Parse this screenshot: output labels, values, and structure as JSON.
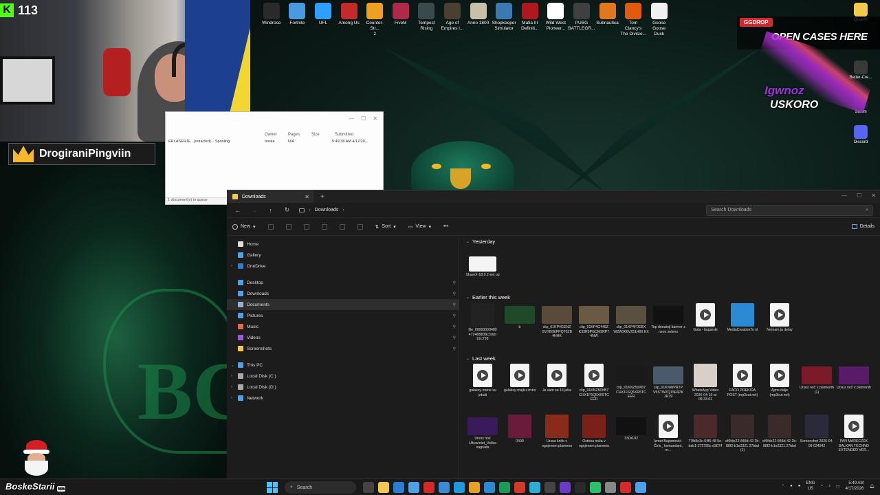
{
  "stream": {
    "kick_count": "113",
    "streamer_name": "DrogiraniPingviin",
    "bottom_name": "BoskeStarii",
    "bottom_tag": "kick"
  },
  "desktop_icons": [
    {
      "label": "Windrose",
      "color": "#2a2a2a"
    },
    {
      "label": "Fortnite",
      "color": "#4a9ae0"
    },
    {
      "label": "UFL",
      "color": "#2fa0ff"
    },
    {
      "label": "Among Us",
      "color": "#c42a2a"
    },
    {
      "label": "Counter-Str...\n2",
      "color": "#f0a020"
    },
    {
      "label": "FiveM",
      "color": "#b0284a"
    },
    {
      "label": "Tempest\nRising",
      "color": "#3a4a4a"
    },
    {
      "label": "Age of\nEmpires I...",
      "color": "#4a4030"
    },
    {
      "label": "Anno 1800",
      "color": "#c8c0a8"
    },
    {
      "label": "Shopkeeper\nSimulator",
      "color": "#3a7ab0"
    },
    {
      "label": "Mafia III\nDefiniti...",
      "color": "#b01820"
    },
    {
      "label": "Wild West\nPioneer...",
      "color": "#ffffff"
    },
    {
      "label": "PUBG\nBATTLEGR...",
      "color": "#404040"
    },
    {
      "label": "Subnautica",
      "color": "#e07820"
    },
    {
      "label": "Tom Clancy's\nThe Divisio...",
      "color": "#e05a10"
    },
    {
      "label": "Goose Goose\nDuck",
      "color": "#f0f0f0"
    }
  ],
  "right_icons": [
    {
      "label": "QuantV",
      "color": "#f2c94c"
    },
    {
      "label": "Better-Cre...",
      "color": "#3a3a3a"
    },
    {
      "label": "Steam",
      "color": "#1b2838"
    },
    {
      "label": "Discord",
      "color": "#5865f2"
    }
  ],
  "ad": {
    "brand": "GGDROP",
    "headline": "OPEN CASES HERE",
    "promo_1": "Igwnoz",
    "promo_2": "USKORO"
  },
  "print_queue": {
    "headers": [
      "Owner",
      "Pages",
      "Size",
      "Submitted"
    ],
    "row": {
      "name": "ERLASERJE...(redacted)... Spooling",
      "owner": "boske",
      "pages": "N/A",
      "size": "",
      "submitted": "5:49:38 AM 4/17/20..."
    },
    "footer": "1 document(s) in queue"
  },
  "explorer": {
    "tab_label": "Downloads",
    "breadcrumb": "Downloads",
    "search_placeholder": "Search Downloads",
    "toolbar": {
      "new": "New",
      "sort": "Sort",
      "view": "View",
      "details": "Details"
    },
    "nav": [
      {
        "label": "Home",
        "color": "#ddd",
        "pinned": false
      },
      {
        "label": "Gallery",
        "color": "#4ea1e8",
        "pinned": false
      },
      {
        "label": "OneDrive",
        "color": "#2a7fd4",
        "pinned": false,
        "expandable": true
      },
      {
        "label": "Desktop",
        "color": "#4ea1e8",
        "pinned": true
      },
      {
        "label": "Downloads",
        "color": "#4ea1e8",
        "pinned": true
      },
      {
        "label": "Documents",
        "color": "#9ab0c8",
        "pinned": true,
        "selected": true
      },
      {
        "label": "Pictures",
        "color": "#4ea1e8",
        "pinned": true
      },
      {
        "label": "Music",
        "color": "#e06a4a",
        "pinned": true
      },
      {
        "label": "Videos",
        "color": "#9a5ae0",
        "pinned": true
      },
      {
        "label": "Screenshots",
        "color": "#f2c94c",
        "pinned": true
      },
      {
        "label": "This PC",
        "color": "#4ea1e8",
        "pinned": false,
        "expanded": true
      },
      {
        "label": "Local Disk (C:)",
        "color": "#aaa",
        "pinned": false,
        "expandable": true
      },
      {
        "label": "Local Disk (D:)",
        "color": "#aaa",
        "pinned": false,
        "expandable": true
      },
      {
        "label": "Network",
        "color": "#4ea1e8",
        "pinned": false,
        "expandable": true
      }
    ],
    "groups": [
      {
        "title": "Yesterday"
      },
      {
        "title": "Earlier this week"
      },
      {
        "title": "Last week"
      }
    ],
    "files_yesterday": [
      {
        "name": "ShareX-18.0.2-set up",
        "kind": "installer"
      }
    ],
    "files_week": [
      {
        "name": "file_00000000489 47246B839c3dcb b1c799",
        "kind": "img",
        "color": "#222"
      },
      {
        "name": "b",
        "kind": "vid",
        "color": "#1e4a2a"
      },
      {
        "name": "clip_01KP4GENZ GVYB0EPPQ70ZB 4HHK",
        "kind": "vid",
        "color": "#5a4a3a"
      },
      {
        "name": "clip_01KP4G448Z K33R9PGCM9RP7 4NW",
        "kind": "vid",
        "color": "#6a5a44"
      },
      {
        "name": "clip_01KP4F0EBX W2W266V251H00 KX",
        "kind": "vid",
        "color": "#5a5040"
      },
      {
        "name": "Top donatoji banner z neon zeleno",
        "kind": "vid",
        "color": "#111"
      },
      {
        "name": "Gala - bugarski",
        "kind": "doc"
      },
      {
        "name": "MediaCreationTo ol",
        "kind": "img",
        "color": "#2a8ad4"
      },
      {
        "name": "Nemam ja delay",
        "kind": "doc"
      }
    ],
    "files_last": [
      {
        "name": "galaksy-mene su jebali",
        "kind": "doc"
      },
      {
        "name": "galaksy-majku izvini",
        "kind": "doc"
      },
      {
        "name": "Ja sam sa 16 jeba",
        "kind": "doc"
      },
      {
        "name": "clip_01KNZ50XB7 CHX1F6Q5XR5TC EER",
        "kind": "doc"
      },
      {
        "name": "clip_01KNZ50XB7 CHX1F6Q5XR5TC EER",
        "kind": "vid",
        "color": "#1a1a1a"
      },
      {
        "name": "clip_01KNWPRTP V5STWZQ15E6PK JR79",
        "kind": "vid",
        "color": "#4a5a6a"
      },
      {
        "name": "WhatsApp Video 2026-04-10 at 08.33.01",
        "kind": "img",
        "color": "#d8d0c8"
      },
      {
        "name": "FAĆO PREKIDA POST (mp3cut.net)",
        "kind": "doc"
      },
      {
        "name": "Ajmo dalje (mp3cut.net)",
        "kind": "doc"
      },
      {
        "name": "Ursus nož v plamenih (1)",
        "kind": "vid",
        "color": "#7a1a2a"
      },
      {
        "name": "Ursus nož v plamenih",
        "kind": "vid",
        "color": "#5a1a6a"
      }
    ],
    "files_last2": [
      {
        "name": "Ursus nož Ultraviolet_Velika nagrada",
        "kind": "vid",
        "color": "#3a1a5a"
      },
      {
        "name": "0409",
        "kind": "img",
        "color": "#6a1a3a"
      },
      {
        "name": "Ursus knife v ognjenem plamenu",
        "kind": "img",
        "color": "#8a2a1a"
      },
      {
        "name": "Ostrina noža v ognjenem plamenu",
        "kind": "img",
        "color": "#7a2018"
      },
      {
        "name": "330x192",
        "kind": "vid",
        "color": "#111"
      },
      {
        "name": "Izmet Bajramović-Čelo_ komandant, m...",
        "kind": "doc"
      },
      {
        "name": "77fb8e3c-04f6-48 5e-bab1-272785c d3074",
        "kind": "img",
        "color": "#4a2a2a"
      },
      {
        "name": "ef6fde22-848d-42 2b-88f2-b1e2321 27bbd (1)",
        "kind": "img",
        "color": "#3a2a2a"
      },
      {
        "name": "ef6fde22-848d-42 2b-88f2-b1e2321 27bbd",
        "kind": "img",
        "color": "#3a2a2a"
      },
      {
        "name": "Screenshot 2026-04-09 024942",
        "kind": "img",
        "color": "#2a2a3a"
      },
      {
        "name": "PAN MARECZEK BALKAN TECHNO EXTENDED VER...",
        "kind": "doc"
      }
    ]
  },
  "taskbar": {
    "search_label": "Search",
    "apps": [
      "#444",
      "#f2c94c",
      "#2a7fd4",
      "#4ea1e8",
      "#d4282d",
      "#3a8ad4",
      "#1e9be0",
      "#e8a020",
      "#2a8ad4",
      "#1b9a5a",
      "#d43a2a",
      "#2ab0d4",
      "#444",
      "#6a3ac8",
      "#2a2a2a",
      "#2ac070",
      "#888",
      "#d82a2a",
      "#4ea1e8"
    ],
    "lang_top": "ENG",
    "lang_bottom": "US",
    "time": "5:49 AM",
    "date": "4/17/2026"
  }
}
